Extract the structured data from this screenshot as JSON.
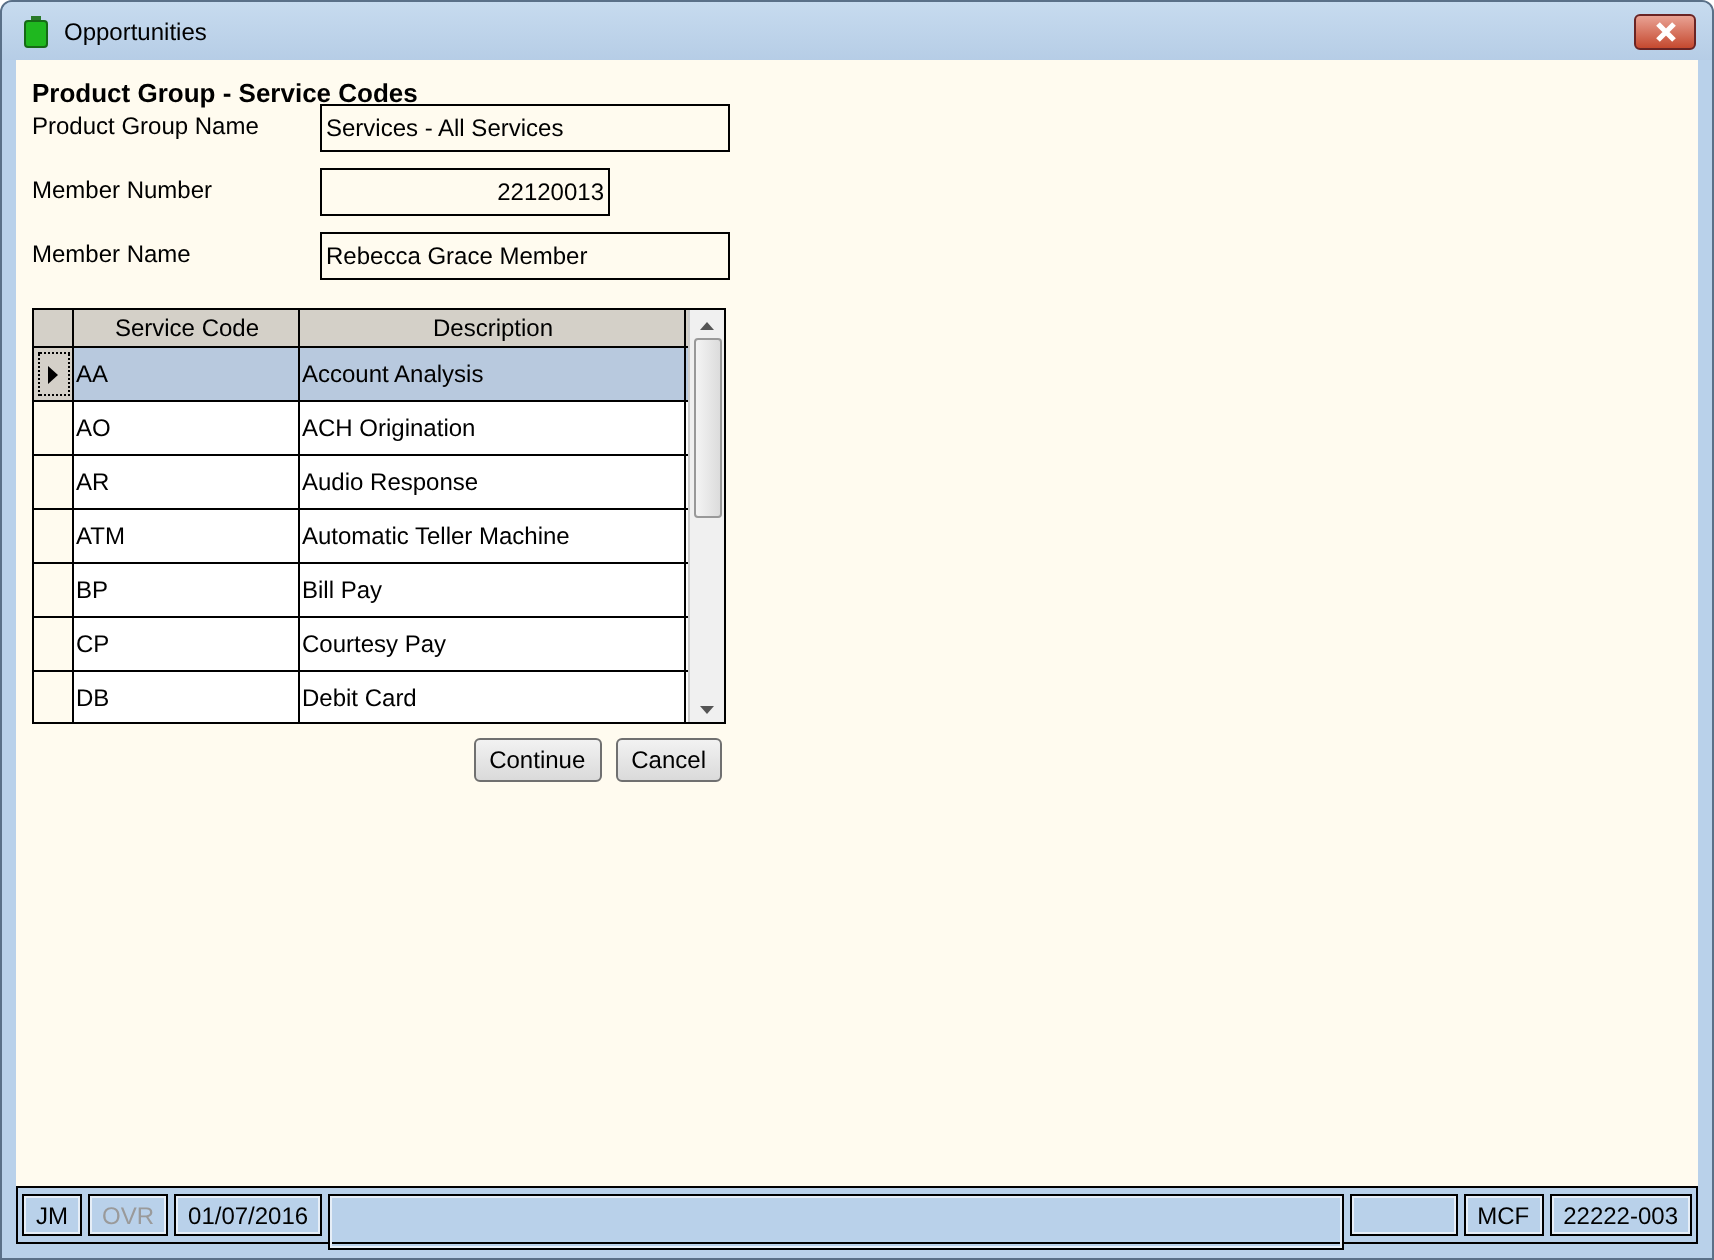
{
  "window": {
    "title": "Opportunities"
  },
  "heading": "Product Group - Service Codes",
  "fields": [
    {
      "label": "Product Group Name",
      "value": "Services - All Services",
      "kind": "text"
    },
    {
      "label": "Member Number",
      "value": "22120013",
      "kind": "number"
    },
    {
      "label": "Member Name",
      "value": "Rebecca Grace Member",
      "kind": "text"
    }
  ],
  "table": {
    "columns": [
      "Service Code",
      "Description"
    ],
    "rows": [
      {
        "cells": [
          "AA",
          "Account Analysis"
        ],
        "selected": true
      },
      {
        "cells": [
          "AO",
          "ACH Origination"
        ],
        "selected": false
      },
      {
        "cells": [
          "AR",
          "Audio Response"
        ],
        "selected": false
      },
      {
        "cells": [
          "ATM",
          "Automatic Teller Machine"
        ],
        "selected": false
      },
      {
        "cells": [
          "BP",
          "Bill Pay"
        ],
        "selected": false
      },
      {
        "cells": [
          "CP",
          "Courtesy Pay"
        ],
        "selected": false
      },
      {
        "cells": [
          "DB",
          "Debit Card"
        ],
        "selected": false
      }
    ]
  },
  "buttons": [
    "Continue",
    "Cancel"
  ],
  "status_bar": [
    {
      "kind": "label",
      "text": "JM",
      "disabled": false
    },
    {
      "kind": "label",
      "text": "OVR",
      "disabled": true
    },
    {
      "kind": "label",
      "text": "01/07/2016",
      "disabled": false
    },
    {
      "kind": "spacer"
    },
    {
      "kind": "gap"
    },
    {
      "kind": "label",
      "text": "MCF",
      "disabled": false
    },
    {
      "kind": "label",
      "text": "22222-003",
      "disabled": false
    }
  ]
}
